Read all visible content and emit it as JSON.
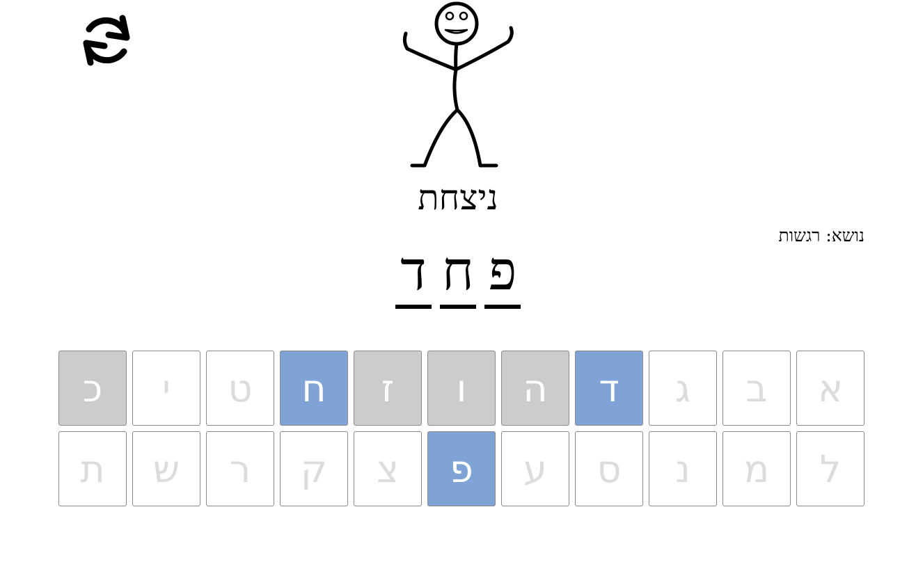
{
  "restart": {
    "icon": "refresh-icon"
  },
  "figure": {
    "icon": "stick-figure-icon",
    "state": "celebrating"
  },
  "status": "ניצחת",
  "topic": "נושא: רגשות",
  "word": {
    "letters": [
      "פ",
      "ח",
      "ד"
    ]
  },
  "keyboard": {
    "colors": {
      "default_bg": "#ffffff",
      "default_text": "#dcdcdc",
      "miss_bg": "#cccccc",
      "hit_bg": "#7fa3d5",
      "pressed_text": "#ffffff"
    },
    "keys": [
      {
        "letter": "א",
        "state": "unused"
      },
      {
        "letter": "ב",
        "state": "unused"
      },
      {
        "letter": "ג",
        "state": "unused"
      },
      {
        "letter": "ד",
        "state": "hit"
      },
      {
        "letter": "ה",
        "state": "miss"
      },
      {
        "letter": "ו",
        "state": "miss"
      },
      {
        "letter": "ז",
        "state": "miss"
      },
      {
        "letter": "ח",
        "state": "hit"
      },
      {
        "letter": "ט",
        "state": "unused"
      },
      {
        "letter": "י",
        "state": "unused"
      },
      {
        "letter": "כ",
        "state": "miss"
      },
      {
        "letter": "ל",
        "state": "unused"
      },
      {
        "letter": "מ",
        "state": "unused"
      },
      {
        "letter": "נ",
        "state": "unused"
      },
      {
        "letter": "ס",
        "state": "unused"
      },
      {
        "letter": "ע",
        "state": "unused"
      },
      {
        "letter": "פ",
        "state": "hit"
      },
      {
        "letter": "צ",
        "state": "unused"
      },
      {
        "letter": "ק",
        "state": "unused"
      },
      {
        "letter": "ר",
        "state": "unused"
      },
      {
        "letter": "ש",
        "state": "unused"
      },
      {
        "letter": "ת",
        "state": "unused"
      }
    ]
  }
}
